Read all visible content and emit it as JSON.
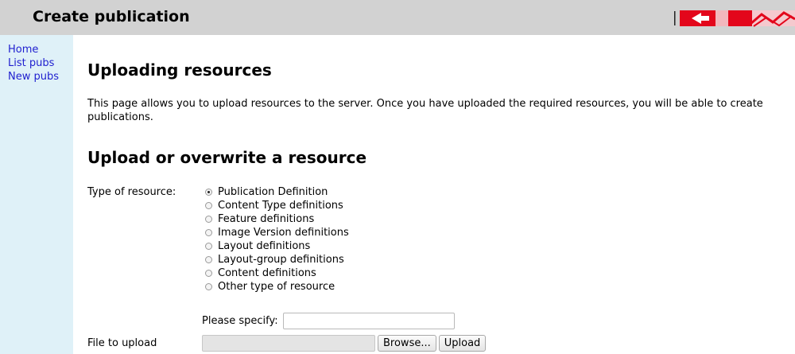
{
  "header": {
    "title": "Create publication"
  },
  "sidebar": {
    "items": [
      {
        "label": "Home"
      },
      {
        "label": "List pubs"
      },
      {
        "label": "New pubs"
      }
    ]
  },
  "main": {
    "heading": "Uploading resources",
    "intro": "This page allows you to upload resources to the server. Once you have uploaded the required resources, you will be able to create publications.",
    "upload_heading": "Upload or overwrite a resource",
    "type_label": "Type of resource:",
    "resource_types": [
      {
        "label": "Publication Definition",
        "checked": true
      },
      {
        "label": "Content Type definitions",
        "checked": false
      },
      {
        "label": "Feature definitions",
        "checked": false
      },
      {
        "label": "Image Version definitions",
        "checked": false
      },
      {
        "label": "Layout definitions",
        "checked": false
      },
      {
        "label": "Layout-group definitions",
        "checked": false
      },
      {
        "label": "Content definitions",
        "checked": false
      },
      {
        "label": "Other type of resource",
        "checked": false
      }
    ],
    "specify_label": "Please specify:",
    "specify_value": "",
    "file_label": "File to upload",
    "browse_label": "Browse...",
    "upload_label": "Upload"
  },
  "colors": {
    "titlebar_bg": "#d2d2d2",
    "sidebar_bg": "#dff1f8",
    "link": "#1f1fcf",
    "logo_red": "#e3061b"
  }
}
